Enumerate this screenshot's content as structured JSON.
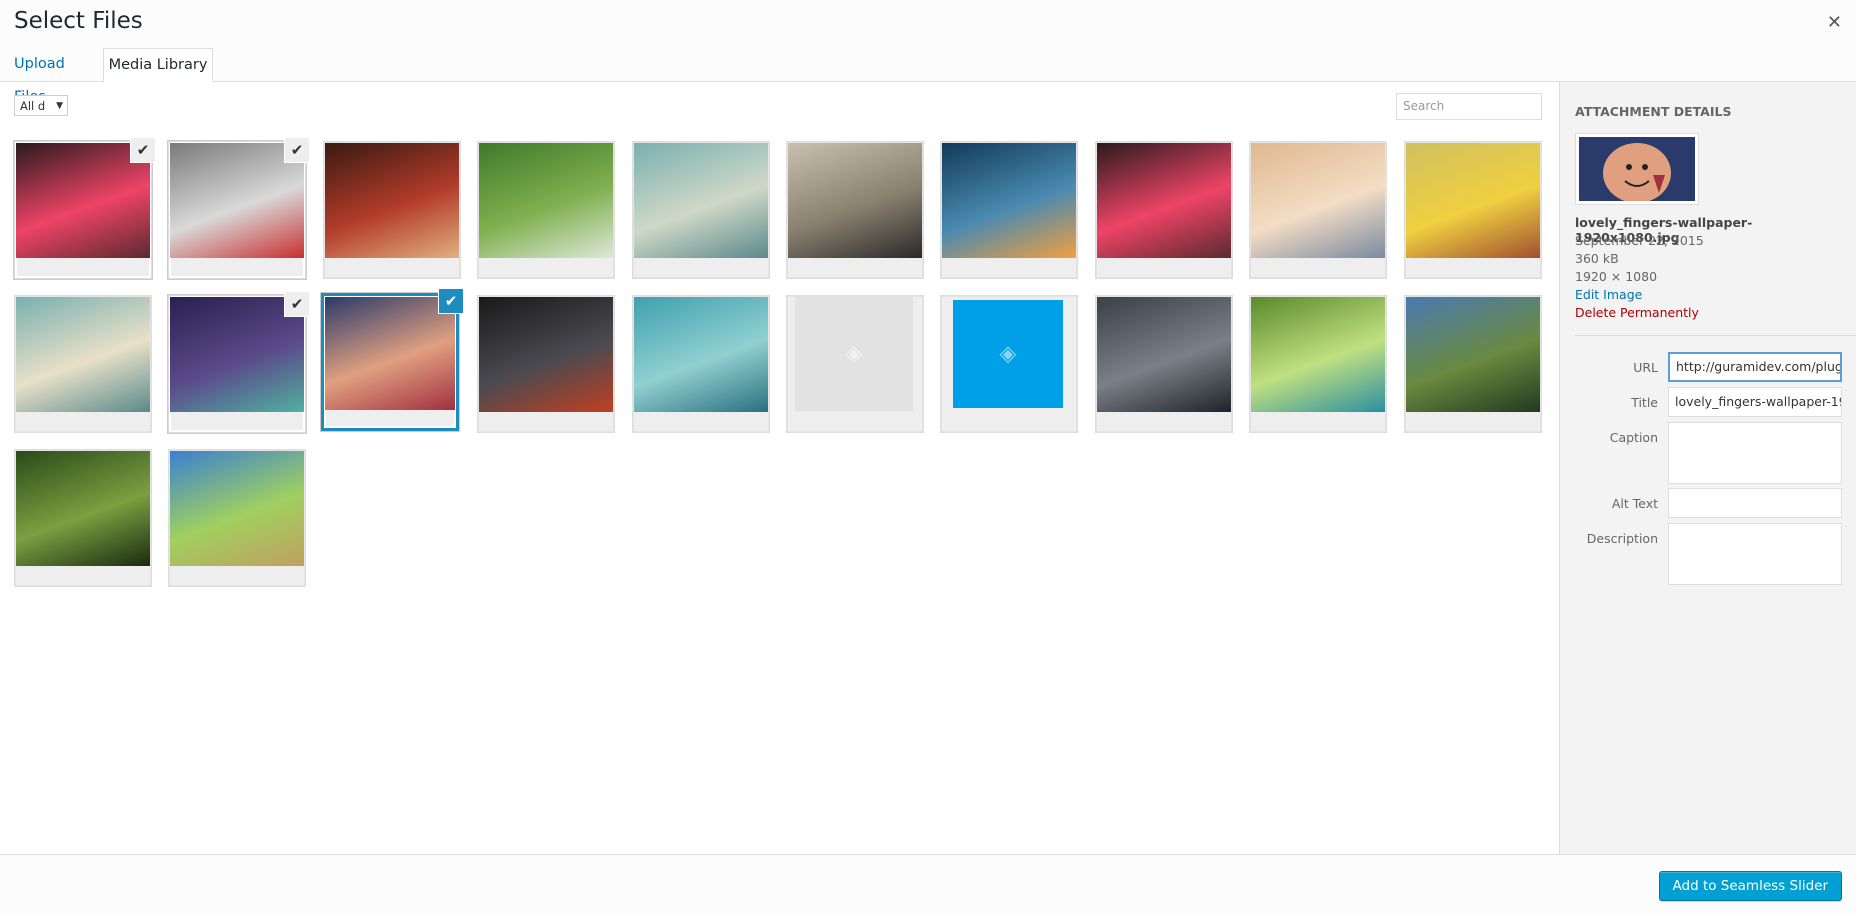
{
  "header": {
    "title": "Select Files",
    "close_icon": "close-icon"
  },
  "tabs": [
    {
      "label": "Upload Files"
    },
    {
      "label": "Media Library"
    }
  ],
  "toolbar": {
    "filter_value": "All d",
    "search_placeholder": "Search"
  },
  "grid": {
    "items": [
      {
        "name": "red balloon",
        "colors": [
          "#2a1a1e",
          "#ee4466",
          "#5a2a30"
        ],
        "checked": true
      },
      {
        "name": "heart easel",
        "colors": [
          "#7a7a7a",
          "#d9d9d9",
          "#c73030"
        ],
        "checked": true
      },
      {
        "name": "apples hearts",
        "colors": [
          "#3a1a12",
          "#b33c2a",
          "#e0b080"
        ],
        "checked": false
      },
      {
        "name": "white rose",
        "colors": [
          "#3f7a2a",
          "#80b050",
          "#dfe7d8"
        ],
        "checked": false
      },
      {
        "name": "dream letters",
        "colors": [
          "#7ab0b0",
          "#cfd8c8",
          "#5a8a8a"
        ],
        "checked": false
      },
      {
        "name": "black hearts",
        "colors": [
          "#c8c0b0",
          "#8a8070",
          "#2a2a2a"
        ],
        "checked": false
      },
      {
        "name": "sunset couple",
        "colors": [
          "#123a5a",
          "#4a8ab0",
          "#f0a040"
        ],
        "checked": false
      },
      {
        "name": "red balloon 2",
        "colors": [
          "#2a1a1e",
          "#ee4466",
          "#5a2a30"
        ],
        "checked": false
      },
      {
        "name": "clouds couple",
        "colors": [
          "#e0b890",
          "#f3ddc5",
          "#7a8aa0"
        ],
        "checked": false
      },
      {
        "name": "couple bench",
        "colors": [
          "#d0c060",
          "#f0d040",
          "#a05030"
        ],
        "checked": false
      },
      {
        "name": "dream letters 2",
        "colors": [
          "#7ab0b0",
          "#e8e0c8",
          "#5a8a8a"
        ],
        "checked": false
      },
      {
        "name": "key bokeh",
        "colors": [
          "#2a2050",
          "#5a4a8a",
          "#50b0a0"
        ],
        "checked": true
      },
      {
        "name": "lovely fingers",
        "colors": [
          "#2a3a6a",
          "#e0a080",
          "#a03040"
        ],
        "checked": true,
        "selected": true
      },
      {
        "name": "bench lights",
        "colors": [
          "#1a1a1a",
          "#4a4a50",
          "#c04020"
        ],
        "checked": false
      },
      {
        "name": "heart island",
        "colors": [
          "#40a0b0",
          "#90d0d0",
          "#2a7080"
        ],
        "checked": false
      },
      {
        "name": "placeholder grey",
        "colors": [
          "#e2e2e2"
        ],
        "checked": false,
        "placeholder": "grey"
      },
      {
        "name": "placeholder blue",
        "colors": [
          "#00a0e8"
        ],
        "checked": false,
        "placeholder": "blue"
      },
      {
        "name": "stormy sea",
        "colors": [
          "#3a4048",
          "#7a8088",
          "#202428"
        ],
        "checked": false
      },
      {
        "name": "waterfall",
        "colors": [
          "#5a8a2a",
          "#c0e080",
          "#2a90a0"
        ],
        "checked": false
      },
      {
        "name": "mountain lake",
        "colors": [
          "#4a7ab0",
          "#6a8a40",
          "#203a20"
        ],
        "checked": false
      },
      {
        "name": "tree road",
        "colors": [
          "#2a4a1a",
          "#7aa040",
          "#1a2a10"
        ],
        "checked": false
      },
      {
        "name": "meadow path",
        "colors": [
          "#3a80d0",
          "#a0d060",
          "#c0a060"
        ],
        "checked": false
      }
    ]
  },
  "sidebar": {
    "heading": "Attachment Details",
    "filename": "lovely_fingers-wallpaper-1920x1080.jpg",
    "date": "September 22, 2015",
    "size": "360 kB",
    "dimensions": "1920 × 1080",
    "edit_link": "Edit Image",
    "delete_link": "Delete Permanently",
    "fields": [
      {
        "label": "URL",
        "value": "http://guramidev.com/plug"
      },
      {
        "label": "Title",
        "value": "lovely_fingers-wallpaper-19"
      },
      {
        "label": "Caption",
        "value": ""
      },
      {
        "label": "Alt Text",
        "value": ""
      },
      {
        "label": "Description",
        "value": ""
      }
    ]
  },
  "footer": {
    "button_label": "Add to Seamless Slider"
  }
}
